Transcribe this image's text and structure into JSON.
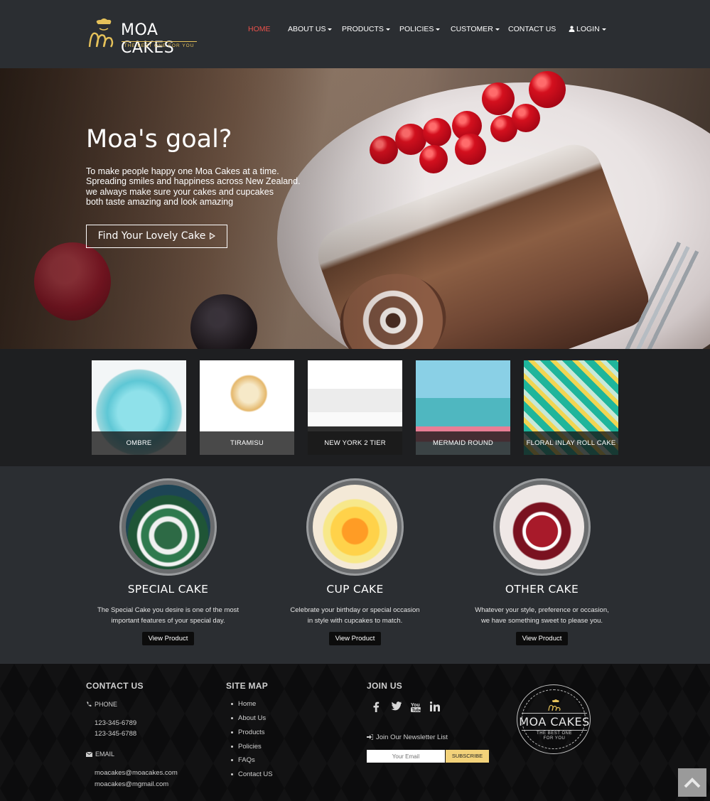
{
  "brand": {
    "name": "MOA CAKES",
    "tagline": "THE BEST ONE FOR YOU"
  },
  "nav": {
    "items": [
      {
        "label": "HOME",
        "active": true,
        "dropdown": false
      },
      {
        "label": "ABOUT US",
        "active": false,
        "dropdown": true
      },
      {
        "label": "PRODUCTS",
        "active": false,
        "dropdown": true
      },
      {
        "label": "POLICIES",
        "active": false,
        "dropdown": true
      },
      {
        "label": "CUSTOMER",
        "active": false,
        "dropdown": true
      },
      {
        "label": "CONTACT US",
        "active": false,
        "dropdown": false
      },
      {
        "label": "LOGIN",
        "active": false,
        "dropdown": true,
        "icon": "user-icon"
      }
    ],
    "active_color": "#e8514a"
  },
  "hero": {
    "title": "Moa's goal?",
    "lines": [
      "To make people happy one Moa Cakes at a time.",
      "Spreading smiles and happiness across New Zealand.",
      "we always make sure your cakes and cupcakes",
      "both taste amazing and look amazing"
    ],
    "button_label": "Find Your Lovely Cake"
  },
  "products": [
    {
      "caption": "OMBRE"
    },
    {
      "caption": "TIRAMISU"
    },
    {
      "caption": "NEW YORK 2 TIER"
    },
    {
      "caption": "MERMAID ROUND"
    },
    {
      "caption": "FLORAL INLAY ROLL CAKE"
    }
  ],
  "features": [
    {
      "title": "SPECIAL CAKE",
      "desc_1": "The Special Cake you desire is one of the most",
      "desc_2": "important features of your special day.",
      "button": "View Product"
    },
    {
      "title": "CUP CAKE",
      "desc_1": "Celebrate your birthday or special occasion",
      "desc_2": "in style with cupcakes to match.",
      "button": "View Product"
    },
    {
      "title": "OTHER CAKE",
      "desc_1": "Whatever your style, preference or occasion,",
      "desc_2": "we have something sweet to please you.",
      "button": "View Product"
    }
  ],
  "footer": {
    "contact": {
      "heading": "CONTACT US",
      "phone_label": "PHONE",
      "phones": [
        "123-345-6789",
        "123-345-6788"
      ],
      "email_label": "EMAIL",
      "emails": [
        "moacakes@moacakes.com",
        "moacakes@mgmail.com"
      ]
    },
    "sitemap": {
      "heading": "SITE MAP",
      "links": [
        "Home",
        "About Us",
        "Products",
        "Policies",
        "FAQs",
        "Contact US"
      ]
    },
    "join": {
      "heading": "JOIN US",
      "social_icons": [
        "facebook-icon",
        "twitter-icon",
        "youtube-icon",
        "linkedin-icon"
      ],
      "newsletter_label": "Join Our Newsletter List",
      "email_placeholder": "Your Email",
      "subscribe_label": "SUBSCRIBE"
    },
    "badge": {
      "name": "MOA CAKES",
      "tagline_1": "THE BEST ONE",
      "tagline_2": "FOR YOU"
    }
  },
  "colors": {
    "header_bg": "#2b2e32",
    "footer_bg": "#0c0c0d",
    "accent": "#e8514a",
    "subscribe": "#f3d27a",
    "gold": "#e6c25a"
  }
}
